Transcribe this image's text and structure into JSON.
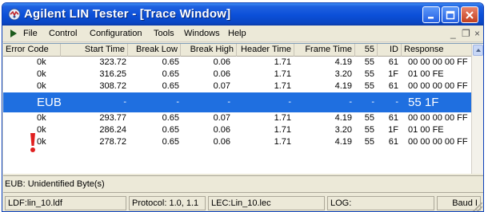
{
  "window": {
    "title": "Agilent LIN Tester - [Trace Window]"
  },
  "menu": [
    "File",
    "Control",
    "Configuration",
    "Tools",
    "Windows",
    "Help"
  ],
  "mdi_controls": [
    "_",
    "❐",
    "×"
  ],
  "table": {
    "columns": [
      "Error Code",
      "Start Time",
      "Break Low",
      "Break High",
      "Header Time",
      "Frame Time",
      "55",
      "ID",
      "Response"
    ],
    "rows": [
      {
        "error": "0k",
        "start": "323.72",
        "blow": "0.65",
        "bhigh": "0.06",
        "header": "1.71",
        "frame": "4.19",
        "sync": "55",
        "id": "61",
        "resp": "00 00 00 00 FF"
      },
      {
        "error": "0k",
        "start": "316.25",
        "blow": "0.65",
        "bhigh": "0.06",
        "header": "1.71",
        "frame": "3.20",
        "sync": "55",
        "id": "1F",
        "resp": "01 00 FE"
      },
      {
        "error": "0k",
        "start": "308.72",
        "blow": "0.65",
        "bhigh": "0.07",
        "header": "1.71",
        "frame": "4.19",
        "sync": "55",
        "id": "61",
        "resp": "00 00 00 00 FF"
      },
      {
        "error": "EUB",
        "start": "-",
        "blow": "-",
        "bhigh": "-",
        "header": "-",
        "frame": "-",
        "sync": "-",
        "id": "-",
        "resp": "55 1F",
        "selected": true
      },
      {
        "error": "0k",
        "start": "293.77",
        "blow": "0.65",
        "bhigh": "0.07",
        "header": "1.71",
        "frame": "4.19",
        "sync": "55",
        "id": "61",
        "resp": "00 00 00 00 FF"
      },
      {
        "error": "0k",
        "start": "286.24",
        "blow": "0.65",
        "bhigh": "0.06",
        "header": "1.71",
        "frame": "3.20",
        "sync": "55",
        "id": "1F",
        "resp": "01 00 FE"
      },
      {
        "error": "0k",
        "start": "278.72",
        "blow": "0.65",
        "bhigh": "0.06",
        "header": "1.71",
        "frame": "4.19",
        "sync": "55",
        "id": "61",
        "resp": "00 00 00 00 FF"
      }
    ]
  },
  "status_line": "EUB: Unidentified Byte(s)",
  "statusbar": {
    "ldf": "LDF:lin_10.ldf",
    "protocol": "Protocol: 1.0, 1.1",
    "lec": "LEC:Lin_10.lec",
    "log": "LOG:",
    "baud": "Baud I"
  }
}
